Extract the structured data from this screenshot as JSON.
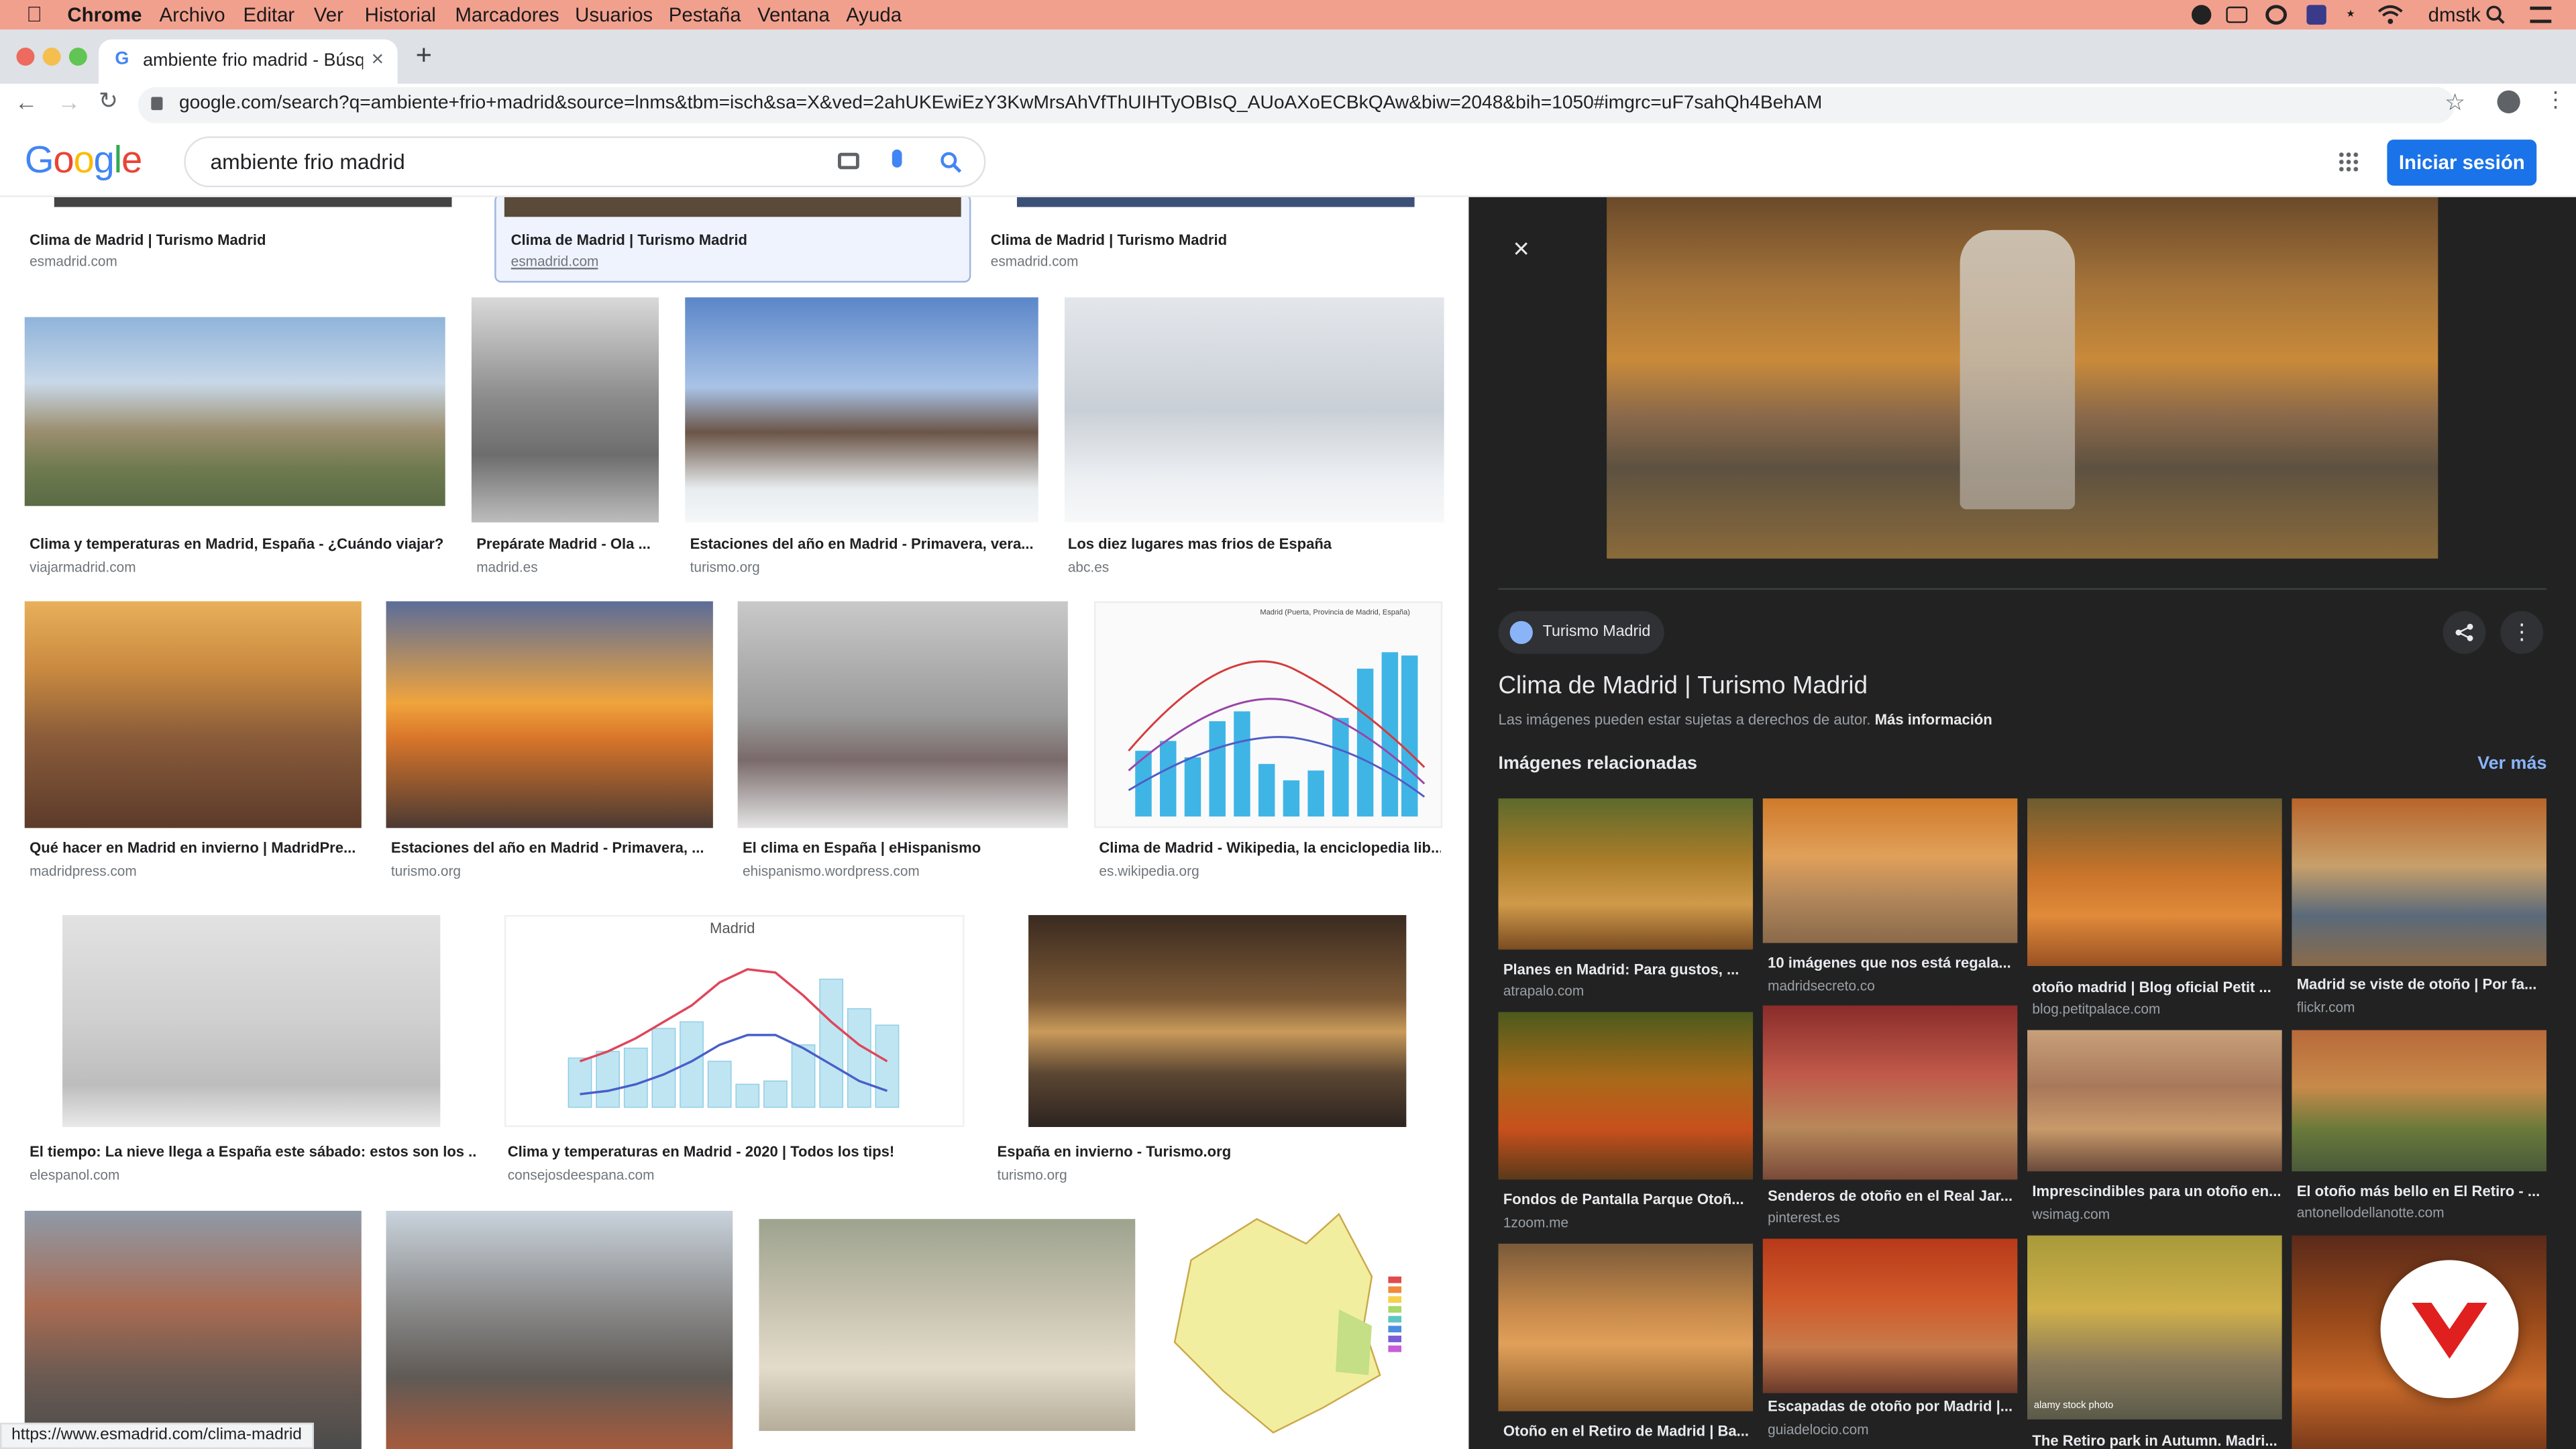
{
  "macos": {
    "apple": "",
    "app": "Chrome",
    "menus": [
      "Archivo",
      "Editar",
      "Ver",
      "Historial",
      "Marcadores",
      "Usuarios",
      "Pestaña",
      "Ventana",
      "Ayuda"
    ],
    "user": "dmstk"
  },
  "browser": {
    "tab_title": "ambiente frio madrid - Búsque",
    "url": "google.com/search?q=ambiente+frio+madrid&source=lnms&tbm=isch&sa=X&ved=2ahUKEwiEzY3KwMrsAhVfThUIHTyOBIsQ_AUoAXoECBkQAw&biw=2048&bih=1050#imgrc=uF7sahQh4BehAM",
    "status_url": "https://www.esmadrid.com/clima-madrid"
  },
  "google": {
    "logo": "Google",
    "query": "ambiente frio madrid",
    "signin": "Iniciar sesión"
  },
  "results": {
    "row0": [
      {
        "cap": "Clima de Madrid | Turismo Madrid",
        "dom": "esmadrid.com"
      },
      {
        "cap": "Clima de Madrid | Turismo Madrid",
        "dom": "esmadrid.com"
      },
      {
        "cap": "Clima de Madrid | Turismo Madrid",
        "dom": "esmadrid.com"
      }
    ],
    "row1": [
      {
        "cap": "Clima y temperaturas en Madrid, España - ¿Cuándo viajar?",
        "dom": "viajarmadrid.com"
      },
      {
        "cap": "Prepárate Madrid - Ola ...",
        "dom": "madrid.es"
      },
      {
        "cap": "Estaciones del año en Madrid - Primavera, vera...",
        "dom": "turismo.org"
      },
      {
        "cap": "Los diez lugares mas frios de España",
        "dom": "abc.es"
      }
    ],
    "row2": [
      {
        "cap": "Qué hacer en Madrid en invierno | MadridPre...",
        "dom": "madridpress.com"
      },
      {
        "cap": "Estaciones del año en Madrid - Primavera, ...",
        "dom": "turismo.org"
      },
      {
        "cap": "El clima en España | eHispanismo",
        "dom": "ehispanismo.wordpress.com"
      },
      {
        "cap": "Clima de Madrid - Wikipedia, la enciclopedia lib...",
        "dom": "es.wikipedia.org"
      }
    ],
    "row3": [
      {
        "cap": "El tiempo: La nieve llega a España este sábado: estos son los ...",
        "dom": "elespanol.com"
      },
      {
        "cap": "Clima y temperaturas en Madrid - 2020 | Todos los tips!",
        "dom": "consejosdeespana.com"
      },
      {
        "cap": "España en invierno - Turismo.org",
        "dom": "turismo.org"
      }
    ],
    "chart_title": "Madrid",
    "wiki_chart_title": "Madrid (Puerta, Provincia de Madrid, España)"
  },
  "panel": {
    "source": "Turismo Madrid",
    "title": "Clima de Madrid | Turismo Madrid",
    "copyright": "Las imágenes pueden estar sujetas a derechos de autor.",
    "more_info": "Más información",
    "related_heading": "Imágenes relacionadas",
    "see_more": "Ver más",
    "watermark": "alamy stock photo",
    "related": [
      {
        "cap": "Planes en Madrid: Para gustos, ...",
        "dom": "atrapalo.com"
      },
      {
        "cap": "10 imágenes que nos está regala...",
        "dom": "madridsecreto.co"
      },
      {
        "cap": "otoño madrid | Blog oficial Petit ...",
        "dom": "blog.petitpalace.com"
      },
      {
        "cap": "Madrid se viste de otoño | Por fa...",
        "dom": "flickr.com"
      },
      {
        "cap": "Fondos de Pantalla Parque Otoñ...",
        "dom": "1zoom.me"
      },
      {
        "cap": "Senderos de otoño en el Real Jar...",
        "dom": "pinterest.es"
      },
      {
        "cap": "Imprescindibles para un otoño en...",
        "dom": "wsimag.com"
      },
      {
        "cap": "El otoño más bello en El Retiro - ...",
        "dom": "antonellodellanotte.com"
      },
      {
        "cap": "Otoño en el Retiro de Madrid | Ba...",
        "dom": ""
      },
      {
        "cap": "Escapadas de otoño por Madrid |...",
        "dom": "guiadelocio.com"
      },
      {
        "cap": "The Retiro park in Autumn. Madri...",
        "dom": ""
      }
    ]
  }
}
